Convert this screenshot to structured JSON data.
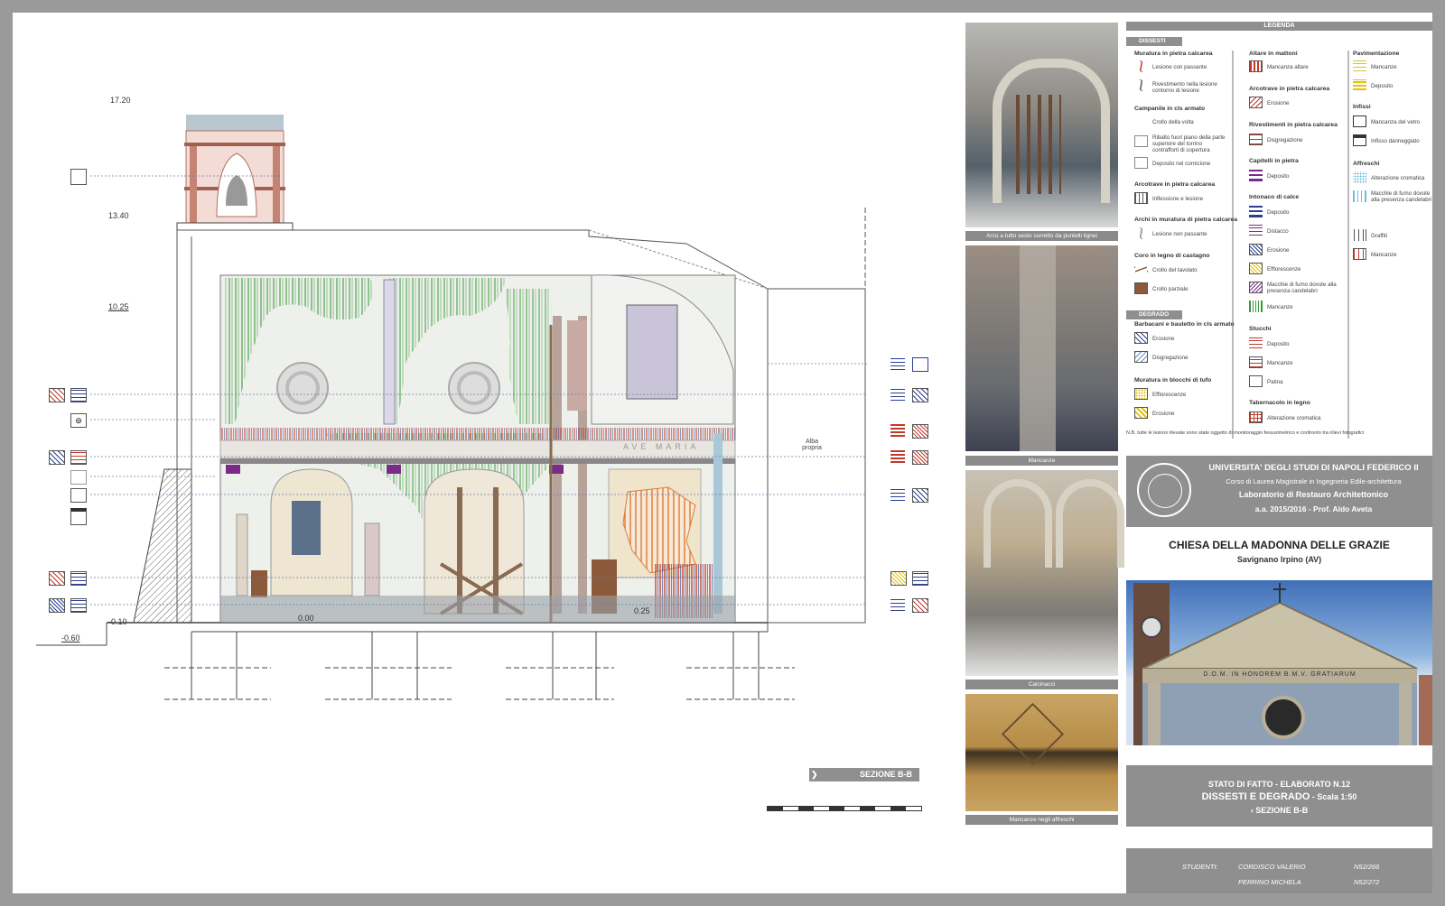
{
  "levels": {
    "l1720": "17.20",
    "l1340": "13.40",
    "l1025": "10.25",
    "l000": "0.00",
    "l025": "0.25",
    "lm010": "-0.10",
    "lm060": "-0.60"
  },
  "drawing": {
    "ave_maria": "AVE MARIA",
    "altezza": [
      "Alba",
      "propria"
    ],
    "section_label": "SEZIONE B-B"
  },
  "photos": [
    {
      "caption": "Arco a tutto sesto sorretto da puntelli lignei"
    },
    {
      "caption": "Mancanze"
    },
    {
      "caption": "Calcinacci"
    },
    {
      "caption": "Mancanze negli affreschi"
    }
  ],
  "legend": {
    "title": "LEGENDA",
    "dissesti_tag": "DISSESTI",
    "degrado_tag": "DEGRADO",
    "col1": [
      {
        "h": "Muratura in pietra calcarea",
        "items": [
          "Lesione con passante",
          "Rivestimento nella lesione contorno di lesione"
        ]
      },
      {
        "h": "Campanile in cls armato",
        "items": [
          "Crollo della volta",
          "Ribalto fuori piano della parte superiore del torrino contrafforti di copertura",
          "Deposito nel cornicione"
        ]
      },
      {
        "h": "Arcotrave in pietra calcarea",
        "items": [
          "Inflessione e lesione"
        ]
      },
      {
        "h": "Archi in muratura di pietra calcarea",
        "items": [
          "Lesione non passante"
        ]
      },
      {
        "h": "Coro in legno di castagno",
        "items": [
          "Crollo del tavolato",
          "Crollo parziale"
        ]
      }
    ],
    "col1b": [
      {
        "h": "Barbacani e bauletto in cls armato",
        "items": [
          "Erosione",
          "Disgregazione"
        ]
      },
      {
        "h": "Muratura in blocchi di tufo",
        "items": [
          "Efflorescenze",
          "Erosione"
        ]
      }
    ],
    "col2": [
      {
        "h": "Altare in mattoni",
        "items": [
          "Mancanza altare"
        ]
      },
      {
        "h": "Arcotrave in pietra calcarea",
        "items": [
          "Erosione"
        ]
      },
      {
        "h": "Rivestimenti in pietra calcarea",
        "items": [
          "Disgregazione"
        ]
      },
      {
        "h": "Capitelli in pietra",
        "items": [
          "Deposito"
        ]
      },
      {
        "h": "Intonaco di calce",
        "items": [
          "Deposito",
          "Distacco",
          "Erosione",
          "Efflorescenze",
          "Macchie di fumo dovute alla presenza candelabri",
          "Mancanze"
        ]
      },
      {
        "h": "Stucchi",
        "items": [
          "Deposito",
          "Mancanze",
          "Patina"
        ]
      },
      {
        "h": "Tabernacolo in legno",
        "items": [
          "Alterazione cromatica"
        ]
      }
    ],
    "col3": [
      {
        "h": "Pavimentazione",
        "items": [
          "Mancanze",
          "Deposito"
        ]
      },
      {
        "h": "Infissi",
        "items": [
          "Mancanza del vetro",
          "Infisso danneggiato"
        ]
      },
      {
        "h": "Affreschi",
        "items": [
          "Alterazione cromatica",
          "Macchie di fumo dovute alla presenza candelabri",
          "Graffiti",
          "Mancanze"
        ]
      }
    ],
    "note": "N.B. tutte le lesioni rilevate sono state oggetto di monitoraggio fessurimetrico e confronto tra rilievi fotografici"
  },
  "university": {
    "name": "UNIVERSITA' DEGLI STUDI DI NAPOLI FEDERICO II",
    "course": "Corso di Laurea Magistrale in Ingegneria Edile-architettura",
    "lab": "Laboratorio di Restauro Architettonico",
    "year": "a.a. 2015/2016 - Prof. Aldo Aveta"
  },
  "church": {
    "title": "CHIESA DELLA MADONNA DELLE GRAZIE",
    "place": "Savignano Irpino (AV)",
    "facade_text": "D.O.M. IN HONOREM B.M.V. GRATIARUM"
  },
  "elaborato": {
    "line1": "STATO DI FATTO - ELABORATO N.12",
    "line2": "DISSESTI E DEGRADO",
    "scale": " - Scala 1:50",
    "line3": "SEZIONE B-B"
  },
  "students": {
    "label": "STUDENTI:",
    "list": [
      {
        "name": "CORDISCO VALERIO",
        "id": "N52/266"
      },
      {
        "name": "PERRINO MICHELA",
        "id": "N52/272"
      }
    ]
  },
  "colors": {
    "green": "#3a9a3a",
    "red": "#c0392b",
    "blue": "#2b3f8f",
    "purple": "#7b2a8a",
    "yellow": "#e0c21a",
    "grey": "#8f8f8f"
  }
}
